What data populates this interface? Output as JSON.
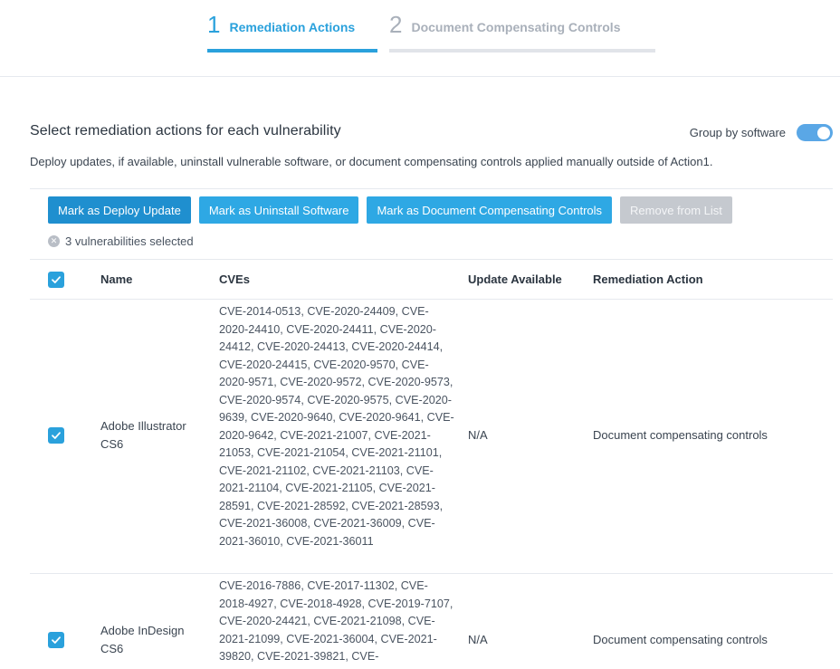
{
  "stepper": {
    "steps": [
      {
        "number": "1",
        "label": "Remediation Actions"
      },
      {
        "number": "2",
        "label": "Document Compensating Controls"
      }
    ]
  },
  "header": {
    "title": "Select remediation actions for each vulnerability",
    "subtitle": "Deploy updates, if available, uninstall vulnerable software, or document compensating controls applied manually outside of Action1.",
    "group_by_label": "Group by software"
  },
  "actions": {
    "deploy": "Mark as Deploy Update",
    "uninstall": "Mark as Uninstall Software",
    "compensate": "Mark as Document Compensating Controls",
    "remove": "Remove from List"
  },
  "selection": {
    "text": "3 vulnerabilities selected"
  },
  "table": {
    "columns": [
      "Name",
      "CVEs",
      "Update Available",
      "Remediation Action"
    ],
    "rows": [
      {
        "name": "Adobe Illustrator CS6",
        "cves": "CVE-2014-0513, CVE-2020-24409, CVE-2020-24410, CVE-2020-24411, CVE-2020-24412, CVE-2020-24413, CVE-2020-24414, CVE-2020-24415, CVE-2020-9570, CVE-2020-9571, CVE-2020-9572, CVE-2020-9573, CVE-2020-9574, CVE-2020-9575, CVE-2020-9639, CVE-2020-9640, CVE-2020-9641, CVE-2020-9642, CVE-2021-21007, CVE-2021-21053, CVE-2021-21054, CVE-2021-21101, CVE-2021-21102, CVE-2021-21103, CVE-2021-21104, CVE-2021-21105, CVE-2021-28591, CVE-2021-28592, CVE-2021-28593, CVE-2021-36008, CVE-2021-36009, CVE-2021-36010, CVE-2021-36011",
        "update_available": "N/A",
        "remediation_action": "Document compensating controls"
      },
      {
        "name": "Adobe InDesign CS6",
        "cves": "CVE-2016-7886, CVE-2017-11302, CVE-2018-4927, CVE-2018-4928, CVE-2019-7107, CVE-2020-24421, CVE-2021-21098, CVE-2021-21099, CVE-2021-36004, CVE-2021-39820, CVE-2021-39821, CVE-",
        "update_available": "N/A",
        "remediation_action": "Document compensating controls"
      }
    ]
  }
}
